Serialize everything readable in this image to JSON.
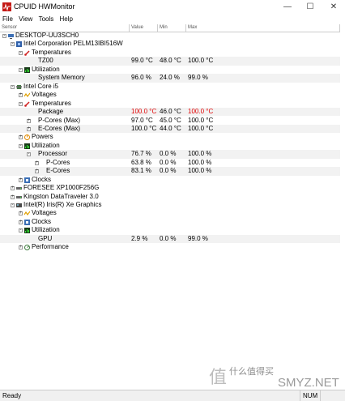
{
  "window": {
    "title": "CPUID HWMonitor",
    "minimize": "—",
    "maximize": "☐",
    "close": "✕"
  },
  "menu": [
    "File",
    "View",
    "Tools",
    "Help"
  ],
  "columns": {
    "sensor": "Sensor",
    "value": "Value",
    "min": "Min",
    "max": "Max"
  },
  "tree": [
    {
      "depth": 0,
      "exp": "-",
      "icon": "computer",
      "label": "DESKTOP-UU3SCH0"
    },
    {
      "depth": 1,
      "exp": "-",
      "icon": "board",
      "label": "Intel Corporation PELM13IBI516W"
    },
    {
      "depth": 2,
      "exp": "-",
      "icon": "thermo",
      "label": "Temperatures"
    },
    {
      "depth": 3,
      "icon": "",
      "label": "TZ00",
      "v": "99.0 °C",
      "min": "48.0 °C",
      "max": "100.0 °C",
      "alt": true
    },
    {
      "depth": 2,
      "exp": "-",
      "icon": "util",
      "label": "Utilization"
    },
    {
      "depth": 3,
      "icon": "",
      "label": "System Memory",
      "v": "96.0 %",
      "min": "24.0 %",
      "max": "99.0 %",
      "alt": true
    },
    {
      "depth": 1,
      "exp": "-",
      "icon": "chip",
      "label": "Intel Core i5"
    },
    {
      "depth": 2,
      "exp": "+",
      "icon": "volt",
      "label": "Voltages"
    },
    {
      "depth": 2,
      "exp": "-",
      "icon": "thermo",
      "label": "Temperatures"
    },
    {
      "depth": 3,
      "icon": "",
      "label": "Package",
      "v": "100.0 °C",
      "min": "46.0 °C",
      "max": "100.0 °C",
      "red": true,
      "alt": true
    },
    {
      "depth": 3,
      "exp": "+",
      "icon": "",
      "label": "P-Cores (Max)",
      "v": "97.0 °C",
      "min": "45.0 °C",
      "max": "100.0 °C"
    },
    {
      "depth": 3,
      "exp": "+",
      "icon": "",
      "label": "E-Cores (Max)",
      "v": "100.0 °C",
      "min": "44.0 °C",
      "max": "100.0 °C",
      "alt": true
    },
    {
      "depth": 2,
      "exp": "+",
      "icon": "power",
      "label": "Powers"
    },
    {
      "depth": 2,
      "exp": "-",
      "icon": "util",
      "label": "Utilization"
    },
    {
      "depth": 3,
      "exp": "-",
      "icon": "",
      "label": "Processor",
      "v": "76.7 %",
      "min": "0.0 %",
      "max": "100.0 %",
      "alt": true
    },
    {
      "depth": 4,
      "exp": "+",
      "icon": "",
      "label": "P-Cores",
      "v": "63.8 %",
      "min": "0.0 %",
      "max": "100.0 %"
    },
    {
      "depth": 4,
      "exp": "+",
      "icon": "",
      "label": "E-Cores",
      "v": "83.1 %",
      "min": "0.0 %",
      "max": "100.0 %",
      "alt": true
    },
    {
      "depth": 2,
      "exp": "+",
      "icon": "clock",
      "label": "Clocks"
    },
    {
      "depth": 1,
      "exp": "+",
      "icon": "disk",
      "label": "FORESEE XP1000F256G"
    },
    {
      "depth": 1,
      "exp": "+",
      "icon": "disk",
      "label": "Kingston DataTraveler 3.0"
    },
    {
      "depth": 1,
      "exp": "-",
      "icon": "gpu",
      "label": "Intel(R) Iris(R) Xe Graphics"
    },
    {
      "depth": 2,
      "exp": "+",
      "icon": "volt",
      "label": "Voltages"
    },
    {
      "depth": 2,
      "exp": "+",
      "icon": "clock",
      "label": "Clocks"
    },
    {
      "depth": 2,
      "exp": "-",
      "icon": "util",
      "label": "Utilization"
    },
    {
      "depth": 3,
      "icon": "",
      "label": "GPU",
      "v": "2.9 %",
      "min": "0.0 %",
      "max": "99.0 %",
      "alt": true
    },
    {
      "depth": 2,
      "exp": "+",
      "icon": "perf",
      "label": "Performance"
    }
  ],
  "status": {
    "left": "Ready",
    "num": "NUM"
  },
  "watermark": {
    "logo": "值",
    "text": "什么值得买",
    "domain": "SMYZ.NET"
  },
  "colors": {
    "critical": "#e00000",
    "alt_row": "#f2f2f2"
  }
}
